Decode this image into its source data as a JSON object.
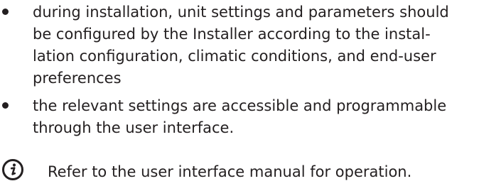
{
  "bullets": [
    {
      "lines": [
        "during installation, unit settings and parameters should",
        "be configured by the Installer according to the instal-",
        "lation configuration, climatic conditions, and end-user",
        "preferences"
      ]
    },
    {
      "lines": [
        "the relevant settings are accessible and programmable",
        "through the user interface."
      ]
    }
  ],
  "note": {
    "icon": "info-icon",
    "text": "Refer to the user interface manual for operation."
  }
}
